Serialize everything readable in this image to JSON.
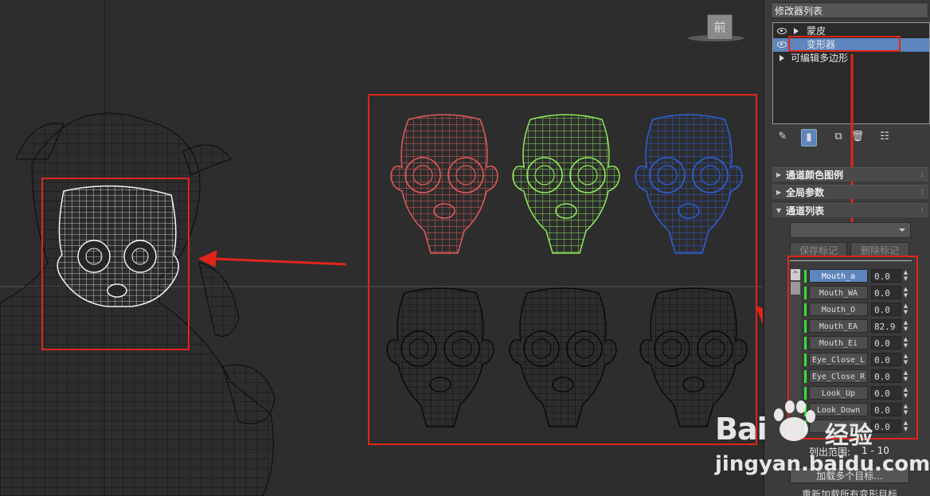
{
  "viewport": {
    "view_cube_label": "前"
  },
  "modifier_panel": {
    "modifier_list_label": "修改器列表",
    "stack": [
      {
        "label": "蒙皮",
        "visible": true,
        "expandable": true
      },
      {
        "label": "变形器",
        "visible": true,
        "expandable": false,
        "selected": true
      },
      {
        "label": "可编辑多边形",
        "visible": false,
        "expandable": true
      }
    ],
    "toolbar": [
      "pin-icon",
      "show-end-result-icon",
      "make-unique-icon",
      "remove-modifier-icon",
      "configure-icon"
    ]
  },
  "rollouts": {
    "channel_color_legend": "通道颜色图例",
    "global_params": "全局参数",
    "channel_list": "通道列表"
  },
  "channel_list": {
    "save_marker": "保存标记",
    "delete_marker": "删除标记",
    "channels": [
      {
        "name": "Mouth_a",
        "value": "0.0"
      },
      {
        "name": "Mouth_WA",
        "value": "0.0"
      },
      {
        "name": "Mouth_O",
        "value": "0.0"
      },
      {
        "name": "Mouth_EA",
        "value": "82.9"
      },
      {
        "name": "Mouth_Ei",
        "value": "0.0"
      },
      {
        "name": "Eye_Close_L",
        "value": "0.0"
      },
      {
        "name": "Eye_Close_R",
        "value": "0.0"
      },
      {
        "name": "Look_Up",
        "value": "0.0"
      },
      {
        "name": "Look_Down",
        "value": "0.0"
      },
      {
        "name": "",
        "value": "0.0"
      }
    ],
    "range_label": "列出范围:",
    "range_value": "1 - 10",
    "load_multiple": "加载多个目标...",
    "reload_all": "重新加载所有变形目标"
  },
  "watermark": {
    "logo": "Bai",
    "brand": "经验",
    "url": "jingyan.baidu.com"
  },
  "colors": {
    "red_head": "#e05a5a",
    "green_head": "#8ee85a",
    "blue_head": "#2f5fd8",
    "annotation": "#e1251b",
    "selection": "#5e85bd"
  }
}
